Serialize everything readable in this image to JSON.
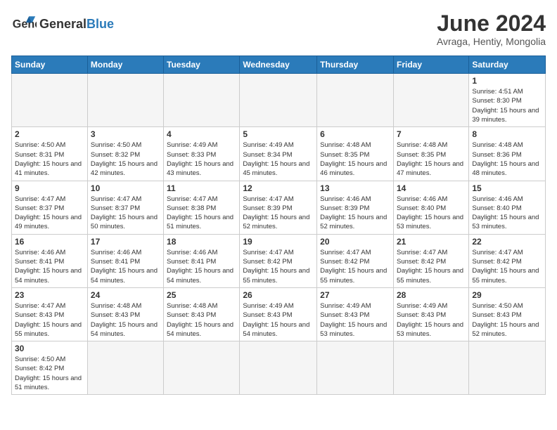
{
  "logo": {
    "text_general": "General",
    "text_blue": "Blue"
  },
  "title": "June 2024",
  "subtitle": "Avraga, Hentiy, Mongolia",
  "days_of_week": [
    "Sunday",
    "Monday",
    "Tuesday",
    "Wednesday",
    "Thursday",
    "Friday",
    "Saturday"
  ],
  "weeks": [
    [
      {
        "day": "",
        "info": ""
      },
      {
        "day": "",
        "info": ""
      },
      {
        "day": "",
        "info": ""
      },
      {
        "day": "",
        "info": ""
      },
      {
        "day": "",
        "info": ""
      },
      {
        "day": "",
        "info": ""
      },
      {
        "day": "1",
        "info": "Sunrise: 4:51 AM\nSunset: 8:30 PM\nDaylight: 15 hours and 39 minutes."
      }
    ],
    [
      {
        "day": "2",
        "info": "Sunrise: 4:50 AM\nSunset: 8:31 PM\nDaylight: 15 hours and 41 minutes."
      },
      {
        "day": "3",
        "info": "Sunrise: 4:50 AM\nSunset: 8:32 PM\nDaylight: 15 hours and 42 minutes."
      },
      {
        "day": "4",
        "info": "Sunrise: 4:49 AM\nSunset: 8:33 PM\nDaylight: 15 hours and 43 minutes."
      },
      {
        "day": "5",
        "info": "Sunrise: 4:49 AM\nSunset: 8:34 PM\nDaylight: 15 hours and 45 minutes."
      },
      {
        "day": "6",
        "info": "Sunrise: 4:48 AM\nSunset: 8:35 PM\nDaylight: 15 hours and 46 minutes."
      },
      {
        "day": "7",
        "info": "Sunrise: 4:48 AM\nSunset: 8:35 PM\nDaylight: 15 hours and 47 minutes."
      },
      {
        "day": "8",
        "info": "Sunrise: 4:48 AM\nSunset: 8:36 PM\nDaylight: 15 hours and 48 minutes."
      }
    ],
    [
      {
        "day": "9",
        "info": "Sunrise: 4:47 AM\nSunset: 8:37 PM\nDaylight: 15 hours and 49 minutes."
      },
      {
        "day": "10",
        "info": "Sunrise: 4:47 AM\nSunset: 8:37 PM\nDaylight: 15 hours and 50 minutes."
      },
      {
        "day": "11",
        "info": "Sunrise: 4:47 AM\nSunset: 8:38 PM\nDaylight: 15 hours and 51 minutes."
      },
      {
        "day": "12",
        "info": "Sunrise: 4:47 AM\nSunset: 8:39 PM\nDaylight: 15 hours and 52 minutes."
      },
      {
        "day": "13",
        "info": "Sunrise: 4:46 AM\nSunset: 8:39 PM\nDaylight: 15 hours and 52 minutes."
      },
      {
        "day": "14",
        "info": "Sunrise: 4:46 AM\nSunset: 8:40 PM\nDaylight: 15 hours and 53 minutes."
      },
      {
        "day": "15",
        "info": "Sunrise: 4:46 AM\nSunset: 8:40 PM\nDaylight: 15 hours and 53 minutes."
      }
    ],
    [
      {
        "day": "16",
        "info": "Sunrise: 4:46 AM\nSunset: 8:41 PM\nDaylight: 15 hours and 54 minutes."
      },
      {
        "day": "17",
        "info": "Sunrise: 4:46 AM\nSunset: 8:41 PM\nDaylight: 15 hours and 54 minutes."
      },
      {
        "day": "18",
        "info": "Sunrise: 4:46 AM\nSunset: 8:41 PM\nDaylight: 15 hours and 54 minutes."
      },
      {
        "day": "19",
        "info": "Sunrise: 4:47 AM\nSunset: 8:42 PM\nDaylight: 15 hours and 55 minutes."
      },
      {
        "day": "20",
        "info": "Sunrise: 4:47 AM\nSunset: 8:42 PM\nDaylight: 15 hours and 55 minutes."
      },
      {
        "day": "21",
        "info": "Sunrise: 4:47 AM\nSunset: 8:42 PM\nDaylight: 15 hours and 55 minutes."
      },
      {
        "day": "22",
        "info": "Sunrise: 4:47 AM\nSunset: 8:42 PM\nDaylight: 15 hours and 55 minutes."
      }
    ],
    [
      {
        "day": "23",
        "info": "Sunrise: 4:47 AM\nSunset: 8:43 PM\nDaylight: 15 hours and 55 minutes."
      },
      {
        "day": "24",
        "info": "Sunrise: 4:48 AM\nSunset: 8:43 PM\nDaylight: 15 hours and 54 minutes."
      },
      {
        "day": "25",
        "info": "Sunrise: 4:48 AM\nSunset: 8:43 PM\nDaylight: 15 hours and 54 minutes."
      },
      {
        "day": "26",
        "info": "Sunrise: 4:49 AM\nSunset: 8:43 PM\nDaylight: 15 hours and 54 minutes."
      },
      {
        "day": "27",
        "info": "Sunrise: 4:49 AM\nSunset: 8:43 PM\nDaylight: 15 hours and 53 minutes."
      },
      {
        "day": "28",
        "info": "Sunrise: 4:49 AM\nSunset: 8:43 PM\nDaylight: 15 hours and 53 minutes."
      },
      {
        "day": "29",
        "info": "Sunrise: 4:50 AM\nSunset: 8:43 PM\nDaylight: 15 hours and 52 minutes."
      }
    ],
    [
      {
        "day": "30",
        "info": "Sunrise: 4:50 AM\nSunset: 8:42 PM\nDaylight: 15 hours and 51 minutes."
      },
      {
        "day": "",
        "info": ""
      },
      {
        "day": "",
        "info": ""
      },
      {
        "day": "",
        "info": ""
      },
      {
        "day": "",
        "info": ""
      },
      {
        "day": "",
        "info": ""
      },
      {
        "day": "",
        "info": ""
      }
    ]
  ]
}
